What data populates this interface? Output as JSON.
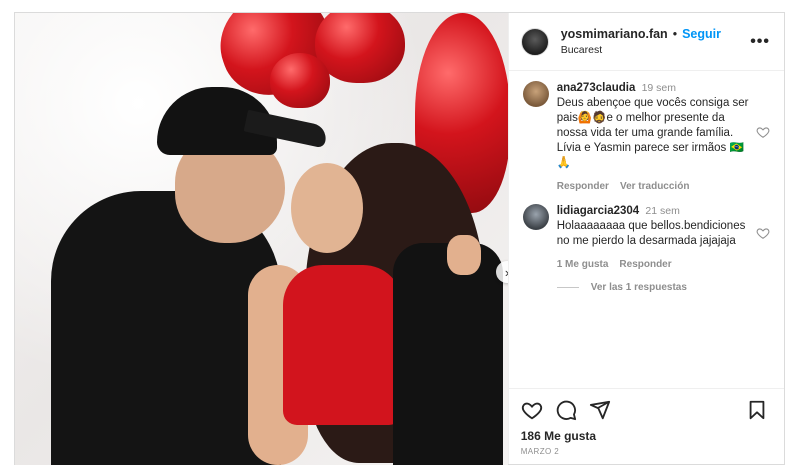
{
  "post": {
    "username": "yosmimariano.fan",
    "separator": "•",
    "follow_label": "Seguir",
    "location": "Bucarest",
    "more_label": "•••"
  },
  "comments": [
    {
      "user": "ana273claudia",
      "time": "19 sem",
      "text": "Deus abençoe que vocês consiga ser pais🙆🧔e o melhor presente da nossa vida ter uma grande família. Lívia e Yasmin parece ser irmãos 🇧🇷🙏",
      "actions": [
        "Responder",
        "Ver traducción"
      ]
    },
    {
      "user": "lidiagarcia2304",
      "time": "21 sem",
      "text": "Holaaaaaaaa que bellos.bendiciones no me pierdo la desarmada jajajaja",
      "actions": [
        "1 Me gusta",
        "Responder"
      ],
      "replies_label": "Ver las 1 respuestas"
    }
  ],
  "footer": {
    "likes": "186 Me gusta",
    "date": "MARZO 2"
  },
  "colors": {
    "accent": "#0095f6",
    "muted": "#8e8e8e",
    "text": "#262626"
  },
  "icons": {
    "like": "heart-icon",
    "comment": "comment-icon",
    "share": "share-icon",
    "save": "bookmark-icon",
    "next": "chevron-right-icon"
  }
}
